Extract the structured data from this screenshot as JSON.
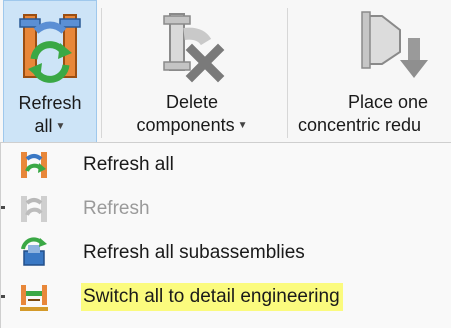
{
  "ribbon": {
    "refresh_button": {
      "line1": "Refresh",
      "line2": "all",
      "icon": "refresh-pipe-icon"
    },
    "delete_button": {
      "line1": "Delete",
      "line2": "components",
      "icon": "delete-component-icon"
    },
    "place_button": {
      "line1": "Place one",
      "line2": "concentric redu",
      "icon": "concentric-reducer-icon"
    }
  },
  "dropdown": {
    "items": [
      {
        "label": "Refresh all",
        "icon": "refresh-all-icon",
        "state": "enabled"
      },
      {
        "label": "Refresh",
        "icon": "refresh-icon",
        "state": "disabled"
      },
      {
        "label": "Refresh all subassemblies",
        "icon": "refresh-subassemblies-icon",
        "state": "enabled"
      },
      {
        "label": "Switch all to detail engineering",
        "icon": "detail-engineering-icon",
        "state": "highlighted"
      }
    ]
  },
  "colors": {
    "selected_button_bg": "#cde4f7",
    "highlight": "#fbfb7e",
    "pipe_orange": "#e8873a",
    "refresh_green": "#3aa845",
    "pipe_blue": "#3a78c4"
  }
}
